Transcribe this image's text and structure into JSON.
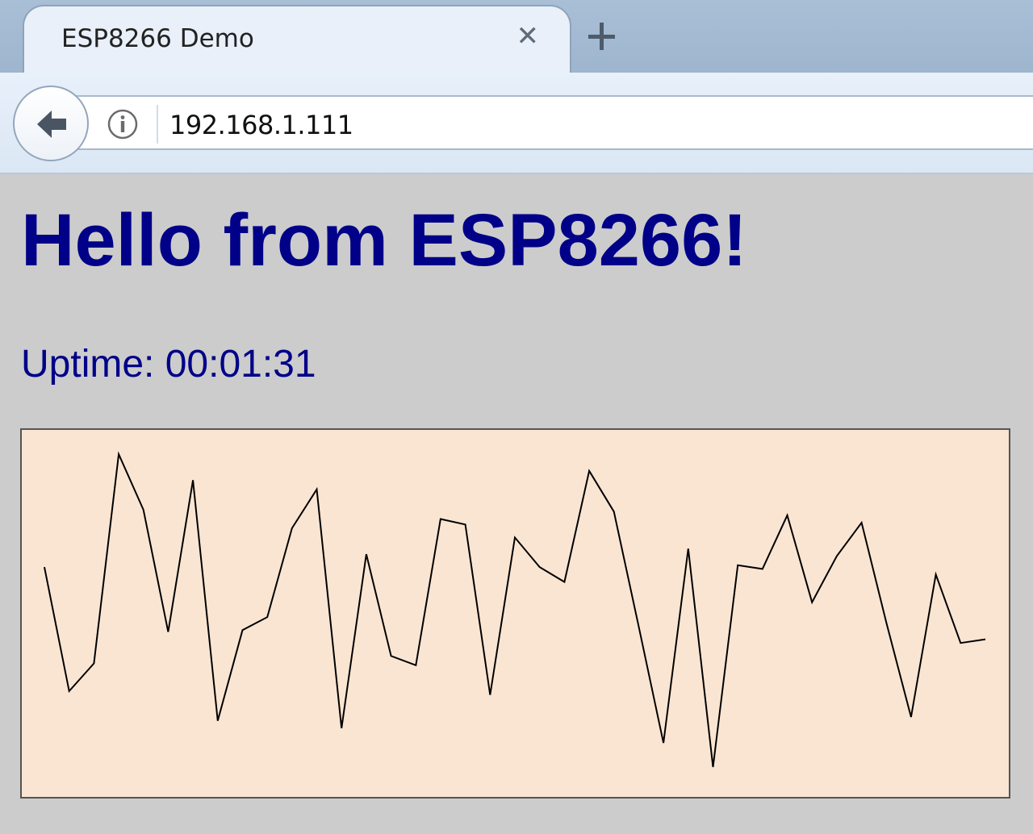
{
  "browser": {
    "tab": {
      "title": "ESP8266 Demo",
      "close_icon": "close-icon"
    },
    "new_tab_icon": "plus-icon",
    "back_icon": "arrow-left-icon",
    "info_icon": "info-icon",
    "url": "192.168.1.111"
  },
  "page": {
    "heading": "Hello from ESP8266!",
    "uptime": "Uptime: 00:01:31",
    "background_color": "#cccccc",
    "text_color": "#000088"
  },
  "chart_data": {
    "type": "line",
    "background_color": "#fae5d3",
    "line_color": "#000000",
    "x": [
      0,
      1,
      2,
      3,
      4,
      5,
      6,
      7,
      8,
      9,
      10,
      11,
      12,
      13,
      14,
      15,
      16,
      17,
      18,
      19,
      20,
      21,
      22,
      23,
      24,
      25,
      26,
      27,
      28,
      29,
      30,
      31,
      32,
      33,
      34,
      35,
      36,
      37,
      38
    ],
    "values": [
      0.625,
      0.29,
      0.365,
      0.93,
      0.78,
      0.45,
      0.86,
      0.21,
      0.455,
      0.49,
      0.73,
      0.835,
      0.19,
      0.66,
      0.385,
      0.36,
      0.755,
      0.74,
      0.28,
      0.705,
      0.625,
      0.585,
      0.885,
      0.775,
      0.465,
      0.15,
      0.675,
      0.085,
      0.63,
      0.62,
      0.765,
      0.53,
      0.655,
      0.745,
      0.475,
      0.22,
      0.605,
      0.42,
      0.43
    ],
    "ylim": [
      0,
      1
    ],
    "grid": false,
    "legend": "none"
  }
}
